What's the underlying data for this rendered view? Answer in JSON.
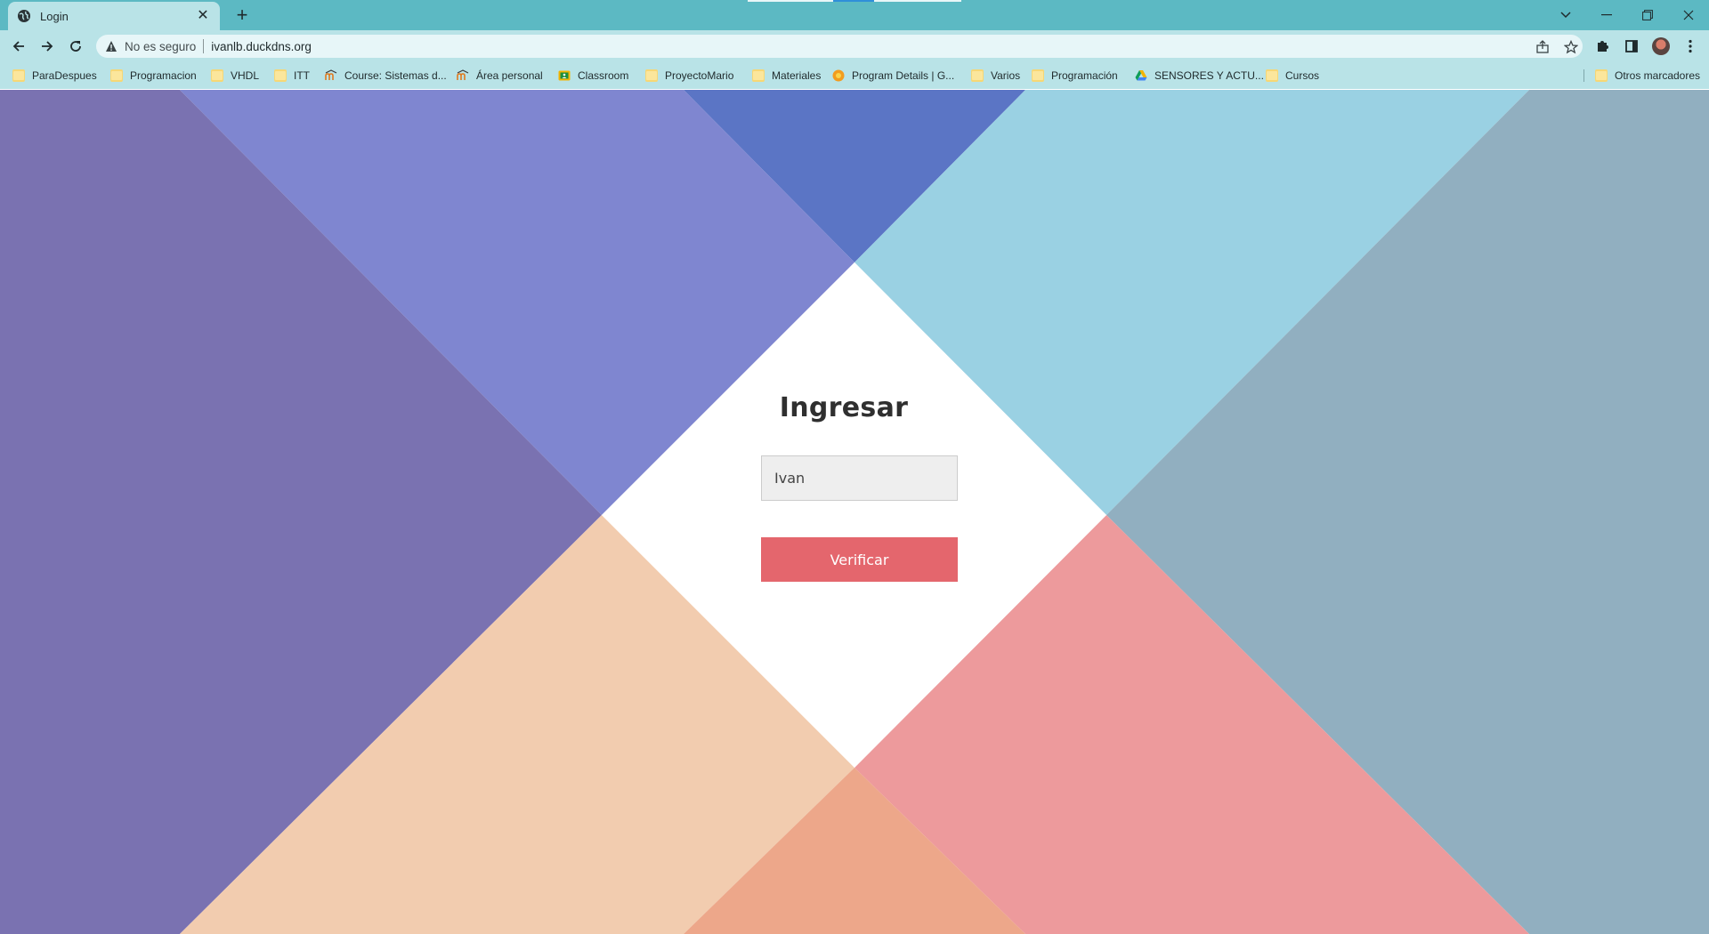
{
  "browser": {
    "tab_title": "Login",
    "security_label": "No es seguro",
    "url": "ivanlb.duckdns.org",
    "bookmarks": [
      {
        "label": "ParaDespues",
        "icon": "folder-icon"
      },
      {
        "label": "Programacion",
        "icon": "folder-icon"
      },
      {
        "label": "VHDL",
        "icon": "folder-icon"
      },
      {
        "label": "ITT",
        "icon": "folder-icon"
      },
      {
        "label": "Course: Sistemas d...",
        "icon": "moodle-icon"
      },
      {
        "label": "Área personal",
        "icon": "moodle-icon"
      },
      {
        "label": "Classroom",
        "icon": "classroom-icon"
      },
      {
        "label": "ProyectoMario",
        "icon": "folder-icon"
      },
      {
        "label": "Materiales",
        "icon": "folder-icon"
      },
      {
        "label": "Program Details | G...",
        "icon": "sun-icon"
      },
      {
        "label": "Varios",
        "icon": "folder-icon"
      },
      {
        "label": "Programación",
        "icon": "folder-icon"
      },
      {
        "label": "SENSORES Y ACTU...",
        "icon": "drive-icon"
      },
      {
        "label": "Cursos",
        "icon": "folder-icon"
      }
    ],
    "other_bookmarks": "Otros marcadores"
  },
  "login": {
    "title": "Ingresar",
    "username_value": "Ivan",
    "submit_label": "Verificar"
  },
  "colors": {
    "chrome_frame": "#5cb9c3",
    "chrome_toolbar": "#b9e3e7",
    "bg_left": "#7a72b1",
    "bg_top_left": "#7f86d0",
    "bg_top_center": "#5b75c5",
    "bg_top_right": "#9ad1e3",
    "bg_right": "#91afc0",
    "bg_bottom_left": "#f2ccaf",
    "bg_bottom_right": "#ed9a9c",
    "bg_bottom_center": "#eda78a",
    "button": "#e4666d"
  }
}
